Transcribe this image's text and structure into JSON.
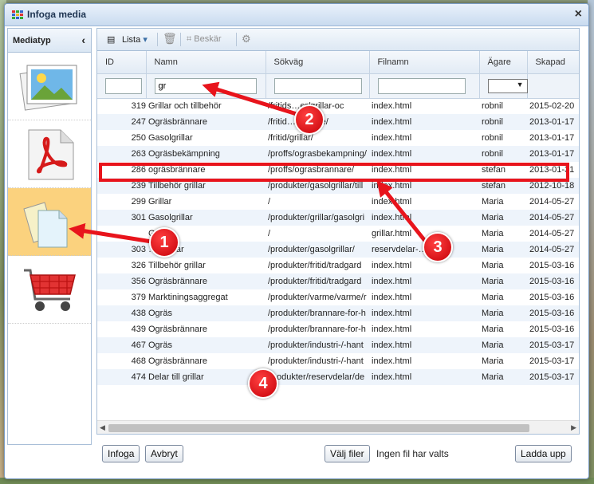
{
  "window": {
    "title": "Infoga media",
    "close_symbol": "×"
  },
  "sidebar": {
    "heading": "Mediatyp",
    "collapse_symbol": "‹",
    "items": [
      {
        "name": "image",
        "selected": false
      },
      {
        "name": "pdf",
        "selected": false
      },
      {
        "name": "documents",
        "selected": true
      },
      {
        "name": "shop-cart",
        "selected": false
      }
    ]
  },
  "toolbar": {
    "view_label": "Lista",
    "crop_label": "Beskär"
  },
  "grid": {
    "columns": [
      "ID",
      "Namn",
      "Sökväg",
      "Filnamn",
      "Ägare",
      "Skapad"
    ],
    "filters": {
      "id": "",
      "name": "gr",
      "path": "",
      "file": "",
      "owner": ""
    },
    "rows": [
      [
        "319",
        "Grillar och tillbehör",
        "/fritids…er/grillar-oc",
        "index.html",
        "robnil",
        "2015-02-20"
      ],
      [
        "247",
        "Ogräsbrännare",
        "/fritid…rannare/",
        "index.html",
        "robnil",
        "2013-01-17"
      ],
      [
        "250",
        "Gasolgrillar",
        "/fritid/grillar/",
        "index.html",
        "robnil",
        "2013-01-17"
      ],
      [
        "263",
        "Ogräsbekämpning",
        "/proffs/ograsbekampning/",
        "index.html",
        "robnil",
        "2013-01-17"
      ],
      [
        "286",
        "ogräsbrännare",
        "/proffs/ograsbrannare/",
        "index.html",
        "stefan",
        "2013-01-31"
      ],
      [
        "239",
        "Tillbehör grillar",
        "/produkter/gasolgrillar/till",
        "index.html",
        "stefan",
        "2012-10-18"
      ],
      [
        "299",
        "Grillar",
        "/",
        "index.html",
        "Maria",
        "2014-05-27"
      ],
      [
        "301",
        "Gasolgrillar",
        "/produkter/grillar/gasolgri",
        "index.html",
        "Maria",
        "2014-05-27"
      ],
      [
        "",
        "G",
        "/",
        "grillar.html",
        "Maria",
        "2014-05-27"
      ],
      [
        "303",
        "…r grillar",
        "/produkter/gasolgrillar/",
        "reservdelar-…",
        "Maria",
        "2014-05-27"
      ],
      [
        "326",
        "Tillbehör grillar",
        "/produkter/fritid/tradgard",
        "index.html",
        "Maria",
        "2015-03-16"
      ],
      [
        "356",
        "Ogräsbrännare",
        "/produkter/fritid/tradgard",
        "index.html",
        "Maria",
        "2015-03-16"
      ],
      [
        "379",
        "Marktiningsaggregat",
        "/produkter/varme/varme/r",
        "index.html",
        "Maria",
        "2015-03-16"
      ],
      [
        "438",
        "Ogräs",
        "/produkter/brannare-for-h",
        "index.html",
        "Maria",
        "2015-03-16"
      ],
      [
        "439",
        "Ogräsbrännare",
        "/produkter/brannare-for-h",
        "index.html",
        "Maria",
        "2015-03-16"
      ],
      [
        "467",
        "Ogräs",
        "/produkter/industri-/-hant",
        "index.html",
        "Maria",
        "2015-03-17"
      ],
      [
        "468",
        "Ogräsbrännare",
        "/produkter/industri-/-hant",
        "index.html",
        "Maria",
        "2015-03-17"
      ],
      [
        "474",
        "Delar till grillar",
        "…odukter/reservdelar/de",
        "index.html",
        "Maria",
        "2015-03-17"
      ]
    ]
  },
  "footer": {
    "insert_label": "Infoga",
    "cancel_label": "Avbryt",
    "choose_files_label": "Välj filer",
    "no_file_text": "Ingen fil har valts",
    "upload_label": "Ladda upp"
  },
  "annotations": {
    "badges": [
      "1",
      "2",
      "3",
      "4"
    ],
    "color": "#e8141c"
  }
}
